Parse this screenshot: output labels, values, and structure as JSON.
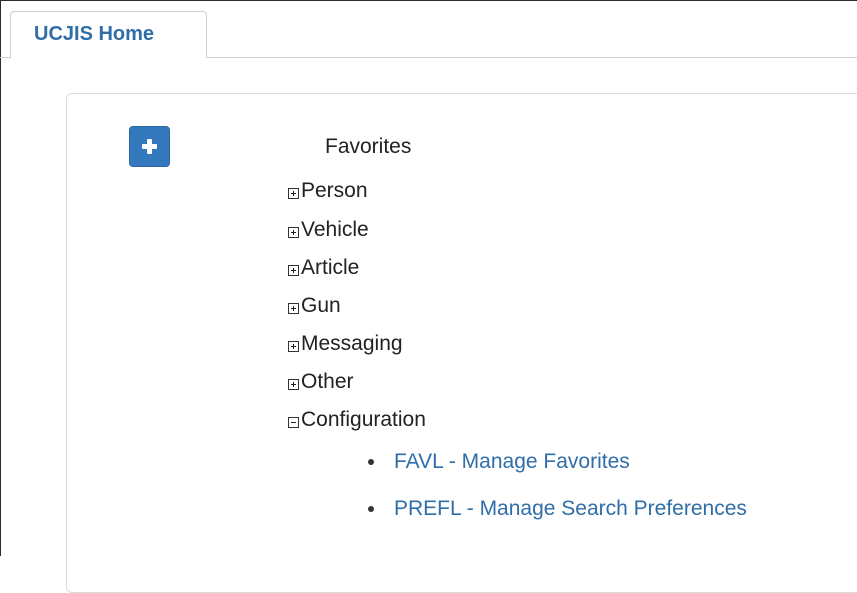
{
  "tabs": [
    {
      "label": "UCJIS Home",
      "active": true
    }
  ],
  "favorites": {
    "title": "Favorites",
    "add_button_icon": "plus-icon",
    "categories": [
      {
        "label": "Person",
        "state": "collapsed"
      },
      {
        "label": "Vehicle",
        "state": "collapsed"
      },
      {
        "label": "Article",
        "state": "collapsed"
      },
      {
        "label": "Gun",
        "state": "collapsed"
      },
      {
        "label": "Messaging",
        "state": "collapsed"
      },
      {
        "label": "Other",
        "state": "collapsed"
      },
      {
        "label": "Configuration",
        "state": "expanded",
        "children": [
          {
            "label": "FAVL - Manage Favorites"
          },
          {
            "label": "PREFL - Manage Search Preferences"
          }
        ]
      }
    ]
  },
  "colors": {
    "accent": "#3479bd",
    "link": "#2f6ea8",
    "text": "#222222"
  }
}
